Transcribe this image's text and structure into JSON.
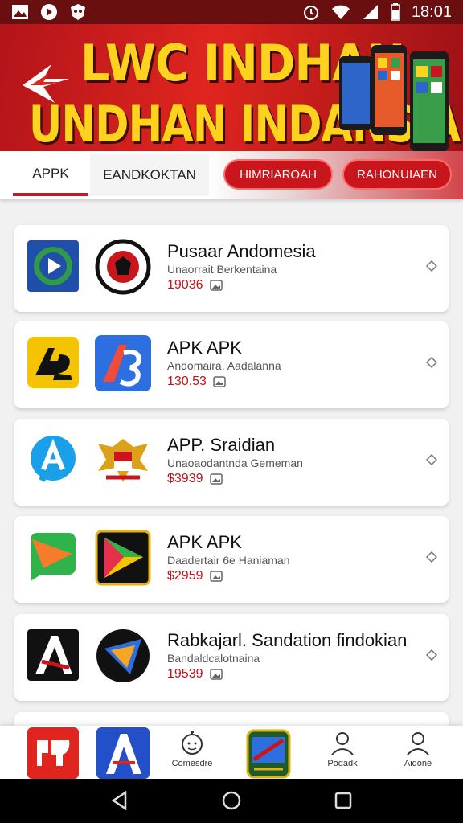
{
  "status_bar": {
    "time": "18:01"
  },
  "hero": {
    "line1": "LWC INDHAN",
    "line2": "UNDHAN INDANSIA"
  },
  "tabs": [
    {
      "label": "APPK"
    },
    {
      "label": "EANDKOKTAN"
    }
  ],
  "pills": [
    {
      "label": "HIMRIAROAH"
    },
    {
      "label": "RAHONUIAEN"
    }
  ],
  "cards": [
    {
      "title": "Pusaar Andomesia",
      "subtitle": "Unaorrait Berkentaina",
      "price": "19036"
    },
    {
      "title": "APK APK",
      "subtitle": "Andomaira. Aadalanna",
      "price": "130.53"
    },
    {
      "title": "APP. Sraidian",
      "subtitle": "Unaoaodantnda Gememan",
      "price": "$3939"
    },
    {
      "title": "APK APK",
      "subtitle": "Daadertair 6e Haniaman",
      "price": "$2959"
    },
    {
      "title": "Rabkajarl. Sandation findokian",
      "subtitle": "Bandaldcalotnaina",
      "price": "19539"
    }
  ],
  "bottom_nav": [
    {
      "label": "Comesdre"
    },
    {
      "label": "Podadk"
    },
    {
      "label": "Aidone"
    }
  ],
  "colors": {
    "brand_red": "#c9161d",
    "hero_yellow": "#ffd21e",
    "price_red": "#c0141b"
  }
}
